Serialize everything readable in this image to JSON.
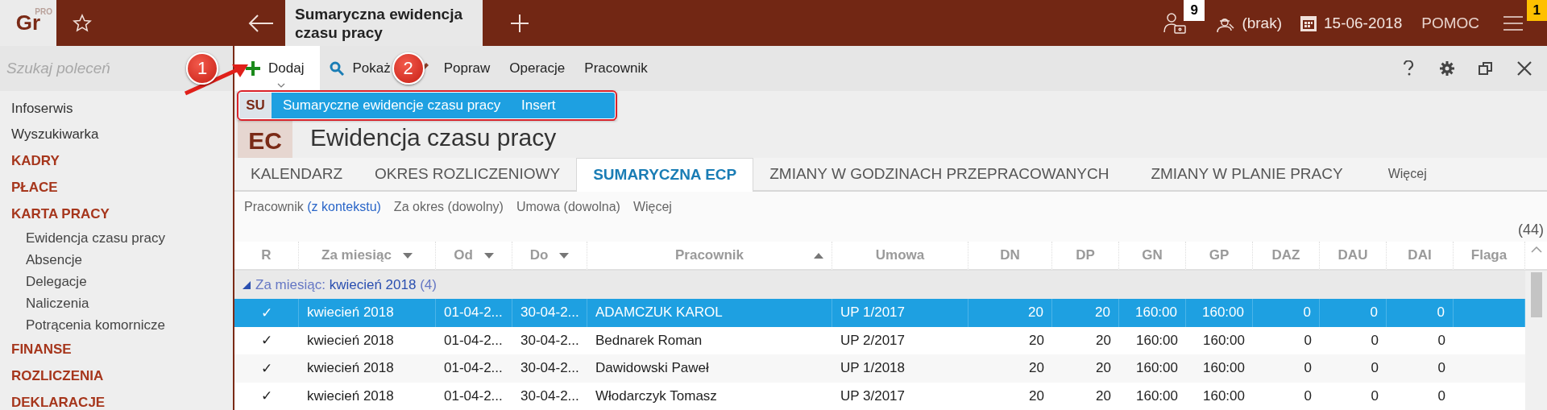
{
  "app": {
    "logo": "Gr",
    "logo_sup": "PRO"
  },
  "topbar": {
    "tabs": [
      {
        "label": "Sumaryczna ewidencja czasu pracy",
        "selected": true
      }
    ],
    "user_badge": "9",
    "operator": "(brak)",
    "date": "15-06-2018",
    "help": "POMOC",
    "menu_badge": "1"
  },
  "sidebar": {
    "search": {
      "placeholder": "Szukaj poleceń"
    },
    "items": [
      {
        "label": "Infoserwis",
        "kind": "link"
      },
      {
        "label": "Wyszukiwarka",
        "kind": "link"
      },
      {
        "label": "KADRY",
        "kind": "section"
      },
      {
        "label": "PŁACE",
        "kind": "section"
      },
      {
        "label": "KARTA PRACY",
        "kind": "section",
        "children": [
          {
            "label": "Ewidencja czasu pracy",
            "kind": "link"
          },
          {
            "label": "Absencje",
            "kind": "link"
          },
          {
            "label": "Delegacje",
            "kind": "link"
          },
          {
            "label": "Naliczenia",
            "kind": "link"
          },
          {
            "label": "Potrącenia komornicze",
            "kind": "link"
          }
        ]
      },
      {
        "label": "FINANSE",
        "kind": "section"
      },
      {
        "label": "ROZLICZENIA",
        "kind": "section"
      },
      {
        "label": "DEKLARACJE",
        "kind": "section"
      }
    ]
  },
  "toolbar": {
    "buttons": [
      {
        "label": "Dodaj",
        "kind": "add",
        "selected": true
      },
      {
        "label": "Pokaż",
        "kind": "show",
        "selected": false
      },
      {
        "label": "Popraw",
        "kind": "edit",
        "selected": false
      },
      {
        "label": "Operacje",
        "kind": "plain",
        "selected": false
      },
      {
        "label": "Pracownik",
        "kind": "plain",
        "selected": false
      }
    ]
  },
  "dropdown": {
    "items": [
      {
        "badge": "SU",
        "label": "Sumaryczne ewidencje czasu pracy",
        "shortcut": "Insert",
        "selected": true
      }
    ]
  },
  "annotations": [
    {
      "label": "1"
    },
    {
      "label": "2"
    }
  ],
  "page": {
    "badge": "EC",
    "title": "Ewidencja czasu pracy"
  },
  "tabs": [
    {
      "label": "KALENDARZ",
      "selected": false
    },
    {
      "label": "OKRES ROZLICZENIOWY",
      "selected": false
    },
    {
      "label": "SUMARYCZNA ECP",
      "selected": true
    },
    {
      "label": "ZMIANY W GODZINACH PRZEPRACOWANYCH",
      "selected": false
    },
    {
      "label": "ZMIANY W PLANIE PRACY",
      "selected": false
    },
    {
      "label": "Więcej",
      "kind": "more",
      "selected": false
    }
  ],
  "filters": [
    {
      "label": "Pracownik",
      "value": "(z kontekstu)",
      "active": true
    },
    {
      "label": "Za okres",
      "value": "(dowolny)",
      "active": false
    },
    {
      "label": "Umowa",
      "value": "(dowolna)",
      "active": false
    },
    {
      "label": "Więcej"
    }
  ],
  "count": "(44)",
  "table": {
    "columns": [
      {
        "label": "R",
        "kind": "check",
        "filter": false,
        "sorted": false
      },
      {
        "label": "Za miesiąc",
        "kind": "text",
        "filter": true,
        "sorted": false
      },
      {
        "label": "Od",
        "kind": "text",
        "filter": true,
        "sorted": false
      },
      {
        "label": "Do",
        "kind": "text",
        "filter": true,
        "sorted": false
      },
      {
        "label": "Pracownik",
        "kind": "text",
        "filter": false,
        "sorted": true
      },
      {
        "label": "Umowa",
        "kind": "text",
        "filter": false,
        "sorted": false
      },
      {
        "label": "DN",
        "kind": "number",
        "filter": false,
        "sorted": false
      },
      {
        "label": "DP",
        "kind": "number",
        "filter": false,
        "sorted": false
      },
      {
        "label": "GN",
        "kind": "number",
        "filter": false,
        "sorted": false
      },
      {
        "label": "GP",
        "kind": "number",
        "filter": false,
        "sorted": false
      },
      {
        "label": "DAZ",
        "kind": "number",
        "filter": false,
        "sorted": false
      },
      {
        "label": "DAU",
        "kind": "number",
        "filter": false,
        "sorted": false
      },
      {
        "label": "DAI",
        "kind": "number",
        "filter": false,
        "sorted": false
      },
      {
        "label": "Flaga",
        "kind": "text",
        "filter": false,
        "sorted": false
      }
    ],
    "group": {
      "label": "Za miesiąc:",
      "value": "kwiecień 2018",
      "count": "(4)",
      "expanded": true
    },
    "rows": [
      {
        "selected": true,
        "cells": [
          "✓",
          "kwiecień 2018",
          "01-04-2...",
          "30-04-2...",
          "ADAMCZUK KAROL",
          "UP 1/2017",
          "20",
          "20",
          "160:00",
          "160:00",
          "0",
          "0",
          "0",
          ""
        ]
      },
      {
        "selected": false,
        "cells": [
          "✓",
          "kwiecień 2018",
          "01-04-2...",
          "30-04-2...",
          "Bednarek Roman",
          "UP 2/2017",
          "20",
          "20",
          "160:00",
          "160:00",
          "0",
          "0",
          "0",
          ""
        ]
      },
      {
        "selected": false,
        "cells": [
          "✓",
          "kwiecień 2018",
          "01-04-2...",
          "30-04-2...",
          "Dawidowski Paweł",
          "UP 1/2018",
          "20",
          "20",
          "160:00",
          "160:00",
          "0",
          "0",
          "0",
          ""
        ]
      },
      {
        "selected": false,
        "cells": [
          "✓",
          "kwiecień 2018",
          "01-04-2...",
          "30-04-2...",
          "Włodarczyk Tomasz",
          "UP 3/2017",
          "20",
          "20",
          "160:00",
          "160:00",
          "0",
          "0",
          "0",
          ""
        ]
      }
    ]
  }
}
